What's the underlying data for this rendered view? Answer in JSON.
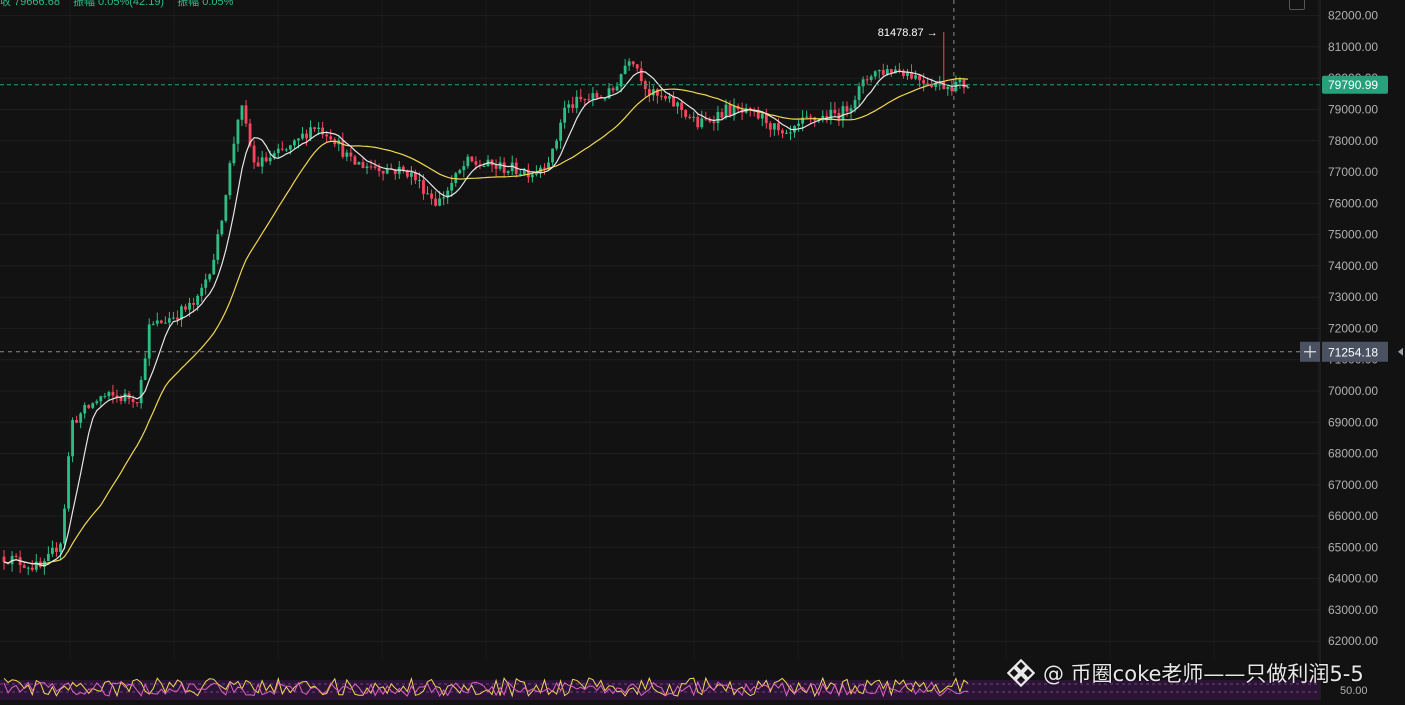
{
  "header": {
    "info_items": [
      "收 79666.68",
      "振幅 0.05%(42.19)",
      "振幅 0.05%"
    ]
  },
  "watermark": {
    "text": "@ 币圈coke老师——只做利润5-5",
    "logo_icon": "binance-diamond-logo"
  },
  "chart_data": {
    "type": "candlestick",
    "y_axis": {
      "ticks": [
        "82000.00",
        "81000.00",
        "80000.00",
        "79000.00",
        "78000.00",
        "77000.00",
        "76000.00",
        "75000.00",
        "74000.00",
        "73000.00",
        "72000.00",
        "71000.00",
        "70000.00",
        "69000.00",
        "68000.00",
        "67000.00",
        "66000.00",
        "65000.00",
        "64000.00",
        "63000.00",
        "62000.00"
      ],
      "range": [
        61400,
        82500
      ],
      "grid": true
    },
    "current_price": {
      "label": "79790.99",
      "value": 79790.99,
      "color": "#26a17b"
    },
    "crosshair": {
      "label": "71254.18",
      "value": 71254.18
    },
    "high_annotation": {
      "label": "81478.87 →",
      "value": 81478.87
    },
    "colors": {
      "up": "#2dbd85",
      "down": "#f6465d",
      "ma_fast": "#e6e6e6",
      "ma_slow": "#f0d850",
      "background": "#121212"
    },
    "price_path": [
      [
        0,
        64700
      ],
      [
        0.04,
        64300
      ],
      [
        0.06,
        65300
      ],
      [
        0.07,
        69000
      ],
      [
        0.1,
        69800
      ],
      [
        0.14,
        69800
      ],
      [
        0.15,
        72000
      ],
      [
        0.2,
        72800
      ],
      [
        0.22,
        74500
      ],
      [
        0.245,
        79200
      ],
      [
        0.26,
        77200
      ],
      [
        0.3,
        77800
      ],
      [
        0.32,
        78500
      ],
      [
        0.34,
        78200
      ],
      [
        0.36,
        77300
      ],
      [
        0.4,
        77100
      ],
      [
        0.42,
        77000
      ],
      [
        0.45,
        76000
      ],
      [
        0.48,
        77300
      ],
      [
        0.55,
        77000
      ],
      [
        0.57,
        77600
      ],
      [
        0.58,
        79000
      ],
      [
        0.6,
        79300
      ],
      [
        0.63,
        79500
      ],
      [
        0.65,
        80800
      ],
      [
        0.67,
        79500
      ],
      [
        0.7,
        79100
      ],
      [
        0.72,
        78500
      ],
      [
        0.75,
        79000
      ],
      [
        0.79,
        78700
      ],
      [
        0.81,
        78000
      ],
      [
        0.83,
        78600
      ],
      [
        0.87,
        78900
      ],
      [
        0.88,
        79300
      ],
      [
        0.9,
        80200
      ],
      [
        0.93,
        80300
      ],
      [
        0.95,
        80000
      ],
      [
        0.97,
        79800
      ],
      [
        1.0,
        79790
      ]
    ],
    "candle_count": 240,
    "indicator_panel": {
      "label": "50.00",
      "levels": [
        30,
        50,
        70
      ]
    }
  }
}
